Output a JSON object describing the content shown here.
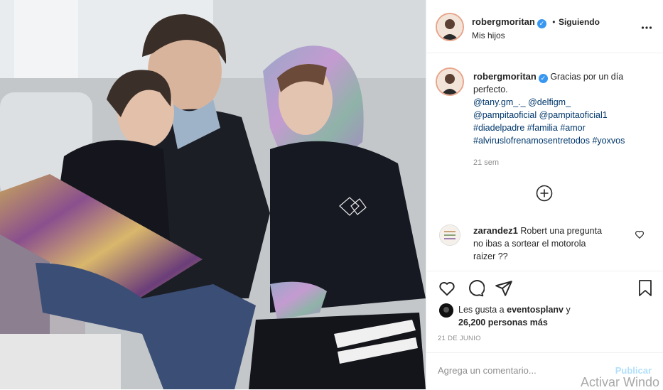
{
  "header": {
    "username": "robergmoritan",
    "follow_status": "Siguiendo",
    "separator": "•",
    "location": "Mis hijos"
  },
  "caption": {
    "username": "robergmoritan",
    "text_line1": "Gracias por un día",
    "text_line2": "perfecto.",
    "mentions_line1_a": "@tany.gm_._",
    "mentions_line1_b": "@delfigm_",
    "mentions_line2_a": "@pampitaoficial",
    "mentions_line2_b": "@pampitaoficial1",
    "tags_line1_a": "#diadelpadre",
    "tags_line1_b": "#familia",
    "tags_line1_c": "#amor",
    "tags_line2_a": "#alviruslofrenamosentretodos",
    "tags_line2_b": "#yoxvos",
    "age": "21 sem"
  },
  "comment": {
    "username": "zarandez1",
    "line1": "Robert una pregunta",
    "line2": "no ibas a sortear el motorola",
    "line3": "raizer ??"
  },
  "likes": {
    "prefix": "Les gusta a",
    "user": "eventosplanv",
    "suffix": "y",
    "count": "26,200 personas más"
  },
  "date": "21 DE JUNIO",
  "comment_box": {
    "placeholder": "Agrega un comentario...",
    "publish_label": "Publicar"
  },
  "watermark": "Activar Windo",
  "colors": {
    "link": "#00376b",
    "verified": "#3897f0",
    "publish": "#b2dffc",
    "muted": "#8e8e8e"
  },
  "icons": [
    "more-options-icon",
    "add-comments-icon",
    "heart-icon",
    "comment-icon",
    "share-icon",
    "bookmark-icon",
    "verified-icon",
    "small-heart-icon"
  ]
}
